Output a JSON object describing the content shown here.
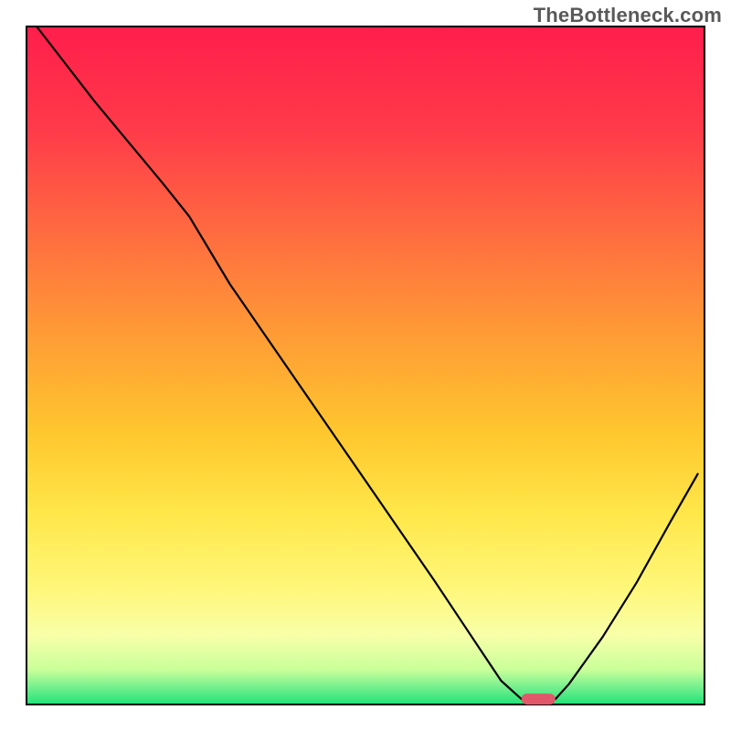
{
  "watermark": "TheBottleneck.com",
  "chart_data": {
    "type": "line",
    "title": "",
    "xlabel": "",
    "ylabel": "",
    "xlim": [
      0,
      100
    ],
    "ylim": [
      0,
      100
    ],
    "grid": false,
    "legend": false,
    "notes": "Background is a vertical red→yellow→green gradient. A single black curve descends from top-left, reaches a floor segment near x≈73–78 (small red pill marker there), then rises toward top-right.",
    "floor_marker": {
      "x_start": 73,
      "x_end": 78,
      "y": 0.8,
      "color": "#e0586a"
    },
    "gradient_stops": [
      {
        "offset": 0.0,
        "color": "#ff1e4b"
      },
      {
        "offset": 0.15,
        "color": "#ff3a4a"
      },
      {
        "offset": 0.3,
        "color": "#ff6a40"
      },
      {
        "offset": 0.45,
        "color": "#ff9a36"
      },
      {
        "offset": 0.6,
        "color": "#ffc72e"
      },
      {
        "offset": 0.72,
        "color": "#ffe74a"
      },
      {
        "offset": 0.83,
        "color": "#fff77a"
      },
      {
        "offset": 0.9,
        "color": "#f7ffa8"
      },
      {
        "offset": 0.95,
        "color": "#c9ff9a"
      },
      {
        "offset": 0.975,
        "color": "#77f08e"
      },
      {
        "offset": 1.0,
        "color": "#25e37a"
      }
    ],
    "series": [
      {
        "name": "curve",
        "x": [
          1.5,
          10,
          20,
          24,
          30,
          40,
          50,
          60,
          67,
          70,
          73,
          78,
          80,
          85,
          90,
          95,
          99
        ],
        "y": [
          100,
          89,
          77,
          72,
          62,
          47.5,
          33,
          18.5,
          8,
          3.5,
          0.8,
          0.8,
          3,
          10,
          18,
          27,
          34
        ]
      }
    ]
  }
}
